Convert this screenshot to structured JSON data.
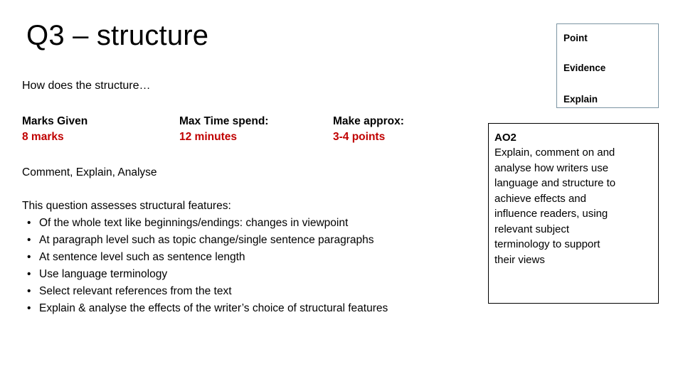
{
  "slide": {
    "title": "Q3 – structure",
    "question_prompt": "How does the structure…"
  },
  "exam_info": {
    "columns": [
      {
        "label": "Marks Given",
        "value": "8 marks"
      },
      {
        "label": "Max Time spend:",
        "value": "12 minutes"
      },
      {
        "label": "Make approx:",
        "value": "3-4 points"
      }
    ]
  },
  "skills_line": "Comment, Explain, Analyse",
  "body": {
    "intro": "This question assesses structural features:",
    "bullet_marker": "•",
    "bullets": [
      "Of the whole text like beginnings/endings: changes in viewpoint",
      "At paragraph level such as topic change/single sentence paragraphs",
      "At sentence level such as sentence length",
      "Use language terminology",
      "Select relevant references from the text",
      "Explain & analyse the effects of the writer’s choice of structural features"
    ]
  },
  "pee_box": {
    "items": [
      "Point",
      "Evidence",
      "Explain"
    ],
    "border_color": "#7B95A3"
  },
  "assessment_objective": {
    "code": "AO2",
    "lines": [
      "Explain, comment on and",
      "analyse how writers use",
      "language and structure to",
      "achieve effects and",
      "influence readers, using",
      "relevant subject",
      "terminology to support",
      "their views"
    ],
    "border_color": "#000000"
  },
  "colors": {
    "accent_red": "#C00000",
    "text": "#000000",
    "background": "#FFFFFF"
  }
}
